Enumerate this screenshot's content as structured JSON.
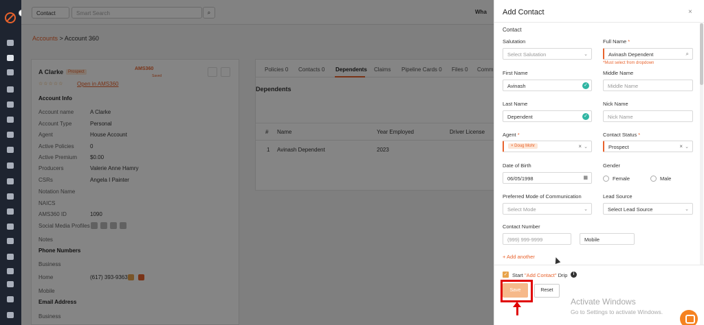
{
  "rail": {
    "items": [
      "dashboard",
      "contacts",
      "documents",
      "accounts",
      "reports",
      "calendar",
      "campaigns",
      "tasks",
      "analytics",
      "files",
      "google",
      "email",
      "schedule",
      "integrations",
      "pipeline",
      "billing",
      "stats",
      "settings"
    ]
  },
  "topbar": {
    "entity_select": "Contact",
    "search_placeholder": "Smart Search",
    "whats_new": "Wha"
  },
  "breadcrumb": {
    "parent": "Accounts",
    "separator": " > ",
    "current": "Account 360"
  },
  "account": {
    "name": "A Clarke",
    "badge": "Prospect",
    "ams_logo": "AMS360",
    "ams_sub": "Saved",
    "stars": "☆☆☆☆☆",
    "open_link": "Open in AMS360",
    "info_heading": "Account Info",
    "fields": [
      {
        "label": "Account name",
        "value": "A Clarke"
      },
      {
        "label": "Account Type",
        "value": "Personal"
      },
      {
        "label": "Agent",
        "value": "House Account"
      },
      {
        "label": "Active Policies",
        "value": "0"
      },
      {
        "label": "Active Premium",
        "value": "$0.00"
      },
      {
        "label": "Producers",
        "value": "Valerie Anne Hamry"
      },
      {
        "label": "CSRs",
        "value": "Angela I Painter"
      },
      {
        "label": "Notation Name",
        "value": ""
      },
      {
        "label": "NAICS",
        "value": ""
      },
      {
        "label": "AMS360 ID",
        "value": "1090"
      },
      {
        "label": "Social Media Profiles",
        "value": ""
      },
      {
        "label": "Notes",
        "value": ""
      }
    ],
    "phone_heading": "Phone Numbers",
    "phones": [
      {
        "label": "Business",
        "value": ""
      },
      {
        "label": "Home",
        "value": "(617) 393-9363"
      },
      {
        "label": "Mobile",
        "value": ""
      }
    ],
    "email_heading": "Email Address",
    "emails": [
      {
        "label": "Business",
        "value": ""
      }
    ]
  },
  "tabs": [
    {
      "label": "Policies",
      "count": "0"
    },
    {
      "label": "Contacts",
      "count": "0"
    },
    {
      "label": "Dependents",
      "count": ""
    },
    {
      "label": "Claims",
      "count": ""
    },
    {
      "label": "Pipeline Cards",
      "count": "0"
    },
    {
      "label": "Files",
      "count": "0"
    },
    {
      "label": "Comm",
      "count": ""
    }
  ],
  "dependents": {
    "title": "Dependents",
    "columns": [
      "#",
      "Name",
      "Year Employed",
      "Driver License"
    ],
    "rows": [
      {
        "num": "1",
        "name": "Avinash Dependent",
        "year": "2023",
        "license": ""
      }
    ]
  },
  "panel": {
    "title": "Add Contact",
    "close": "×",
    "section": "Contact",
    "salutation": {
      "label": "Salutation",
      "placeholder": "Select Salutation"
    },
    "full_name": {
      "label": "Full Name",
      "required": "*",
      "value": "Avinash Dependent",
      "error": "*Must select from dropdown"
    },
    "first_name": {
      "label": "First Name",
      "value": "Avinash"
    },
    "middle_name": {
      "label": "Middle Name",
      "placeholder": "Middle Name"
    },
    "last_name": {
      "label": "Last Name",
      "value": "Dependent"
    },
    "nick_name": {
      "label": "Nick Name",
      "placeholder": "Nick Name"
    },
    "agent": {
      "label": "Agent",
      "required": "*",
      "tag": "Doug Mohr"
    },
    "contact_status": {
      "label": "Contact Status",
      "required": "*",
      "value": "Prospect"
    },
    "dob": {
      "label": "Date of Birth",
      "value": "06/05/1998"
    },
    "gender": {
      "label": "Gender",
      "options": [
        "Female",
        "Male"
      ]
    },
    "pref_mode": {
      "label": "Preferred Mode of Communication",
      "placeholder": "Select Mode"
    },
    "lead_source": {
      "label": "Lead Source",
      "placeholder": "Select Lead Source"
    },
    "contact_number": {
      "label": "Contact Number",
      "placeholder": "(999) 999-9999",
      "type": "Mobile"
    },
    "add_another": "+ Add another",
    "drip": {
      "prefix": "Start ",
      "highlight": "\"Add Contact\"",
      "suffix": " Drip",
      "info": "i"
    },
    "save": "Save",
    "reset": "Reset"
  },
  "watermark": {
    "line1": "Activate Windows",
    "line2": "Go to Settings to activate Windows."
  },
  "colors": {
    "accent": "#e8622c",
    "annotation": "#e00000",
    "success": "#2fb5a3",
    "rail": "#1e2430"
  }
}
